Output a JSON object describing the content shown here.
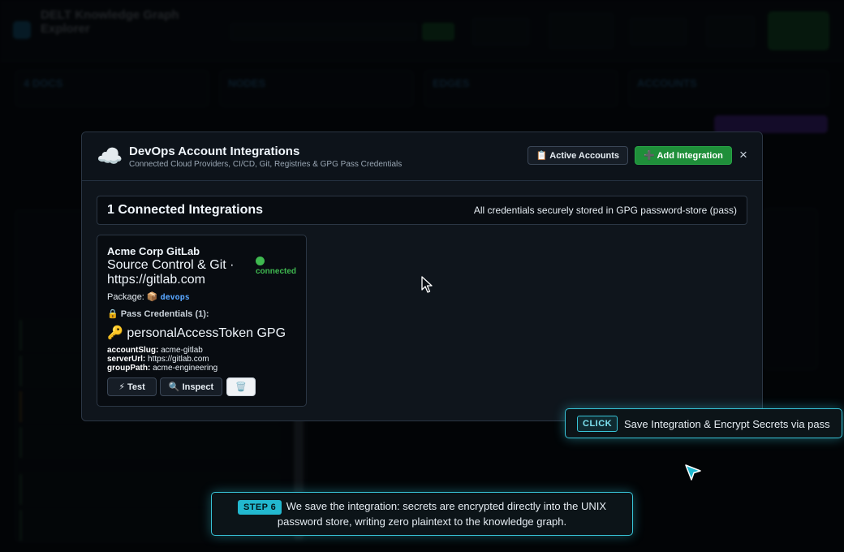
{
  "background": {
    "app_title": "DELT Knowledge Graph Explorer",
    "stat_labels": [
      "4 DOCS",
      "NODES",
      "EDGES",
      "ACCOUNTS"
    ]
  },
  "modal": {
    "icon": "cloud-icon",
    "title": "DevOps Account Integrations",
    "subtitle": "Connected Cloud Providers, CI/CD, Git, Registries & GPG Pass Credentials",
    "active_accounts_label": "📋 Active Accounts",
    "add_integration_label": "➕ Add Integration",
    "close_label": "×"
  },
  "summary": {
    "count_text": "1 Connected Integrations",
    "note": "All credentials securely stored in GPG password-store (pass)"
  },
  "integration": {
    "name": "Acme Corp GitLab",
    "type_line": "Source Control & Git · https://gitlab.com",
    "status": "connected",
    "package_label": "Package: 📦",
    "package": "devops",
    "credentials_label": "🔒 Pass Credentials (1):",
    "credential": "🔑 personalAccessToken GPG",
    "meta": [
      {
        "key": "accountSlug:",
        "value": "acme-gitlab"
      },
      {
        "key": "serverUrl:",
        "value": "https://gitlab.com"
      },
      {
        "key": "groupPath:",
        "value": "acme-engineering"
      }
    ],
    "test_label": "⚡ Test",
    "inspect_label": "🔍 Inspect",
    "delete_label": "🗑️"
  },
  "callout": {
    "tag": "CLICK",
    "text": "Save Integration & Encrypt Secrets via pass"
  },
  "step": {
    "tag": "STEP 6",
    "text": "We save the integration: secrets are encrypted directly into the UNIX password store, writing zero plaintext to the knowledge graph."
  },
  "colors": {
    "accent_cyan": "#38c4d8",
    "success_green": "#3fb950",
    "primary_button": "#1f8f3a"
  }
}
